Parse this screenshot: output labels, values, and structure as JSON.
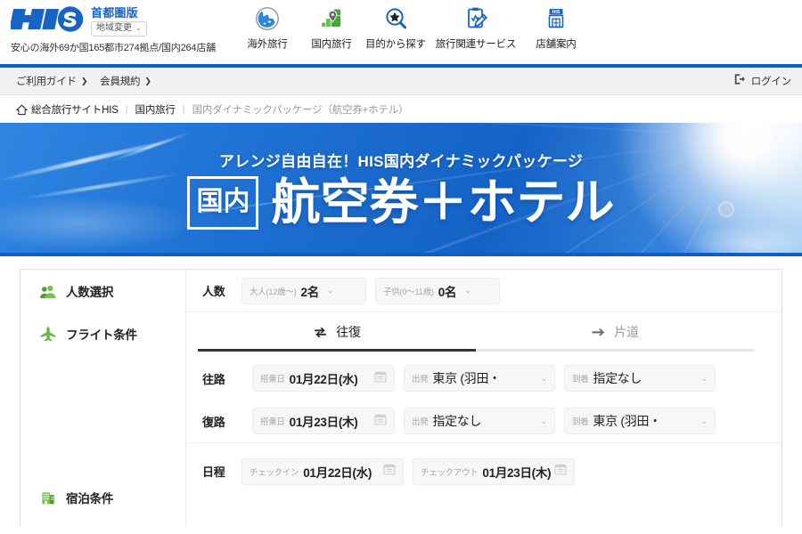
{
  "brand": {
    "logo_icon": "his-logo",
    "region_title": "首都圏版",
    "region_change_label": "地域変更",
    "region_change_icon": "chevron-down-icon",
    "tagline": "安心の海外69か国165都市274拠点/国内264店舗"
  },
  "global_nav": [
    {
      "label": "海外旅行",
      "icon": "globe-icon"
    },
    {
      "label": "国内旅行",
      "icon": "map-pin-icon"
    },
    {
      "label": "目的から探す",
      "icon": "star-magnifier-icon"
    },
    {
      "label": "旅行関連サービス",
      "icon": "clipboard-pen-icon"
    },
    {
      "label": "店舗案内",
      "icon": "storefront-his-icon"
    }
  ],
  "utility_bar": {
    "links": [
      {
        "label": "ご利用ガイド",
        "arrow": "❯"
      },
      {
        "label": "会員規約",
        "arrow": "❯"
      }
    ],
    "login": {
      "label": "ログイン",
      "icon": "login-door-icon"
    }
  },
  "breadcrumb": {
    "home_icon": "home-icon",
    "items": [
      "総合旅行サイトHIS",
      "国内旅行",
      "国内ダイナミックパッケージ（航空券+ホテル）"
    ],
    "separator": "|"
  },
  "hero": {
    "subtitle": "アレンジ自由自在！HIS国内ダイナミックパッケージ",
    "badge": "国内",
    "title": "航空券＋ホテル"
  },
  "search_form": {
    "sections": [
      {
        "label": "人数選択",
        "icon": "people-icon"
      },
      {
        "label": "フライト条件",
        "icon": "airplane-icon"
      },
      {
        "label": "宿泊条件",
        "icon": "hotel-icon"
      }
    ],
    "passengers": {
      "row_key": "人数",
      "adults": {
        "label": "大人(12歳〜)",
        "value": "2名",
        "caret": "⌄"
      },
      "children": {
        "label": "子供(0〜11歳)",
        "value": "0名",
        "caret": "⌄"
      }
    },
    "trip_tabs": [
      {
        "label": "往復",
        "icon": "round-trip-icon",
        "active": true
      },
      {
        "label": "片道",
        "icon": "one-way-icon",
        "active": false
      }
    ],
    "flights": [
      {
        "row_key": "往路",
        "date": {
          "label": "搭乗日",
          "value": "01月22日(水)",
          "icon": "calendar-icon"
        },
        "from": {
          "label": "出発",
          "value": "東京 (羽田・",
          "caret": "⌄"
        },
        "to": {
          "label": "到着",
          "value": "指定なし",
          "caret": "⌄"
        }
      },
      {
        "row_key": "復路",
        "date": {
          "label": "搭乗日",
          "value": "01月23日(木)",
          "icon": "calendar-icon"
        },
        "from": {
          "label": "出発",
          "value": "指定なし",
          "caret": "⌄"
        },
        "to": {
          "label": "到着",
          "value": "東京 (羽田・",
          "caret": "⌄"
        }
      }
    ],
    "stay": {
      "row_key": "日程",
      "checkin": {
        "label": "チェックイン",
        "value": "01月22日(水)",
        "icon": "calendar-icon"
      },
      "checkout": {
        "label": "チェックアウト",
        "value": "01月23日(木)",
        "icon": "calendar-icon"
      }
    }
  },
  "colors": {
    "brand_blue": "#1763c6",
    "rule_blue": "#0c5fc4",
    "hero_blue": "#1e70d2",
    "accent_green": "#5fb23e",
    "tab_active": "#33373c",
    "muted_text": "#9a9a9a"
  }
}
